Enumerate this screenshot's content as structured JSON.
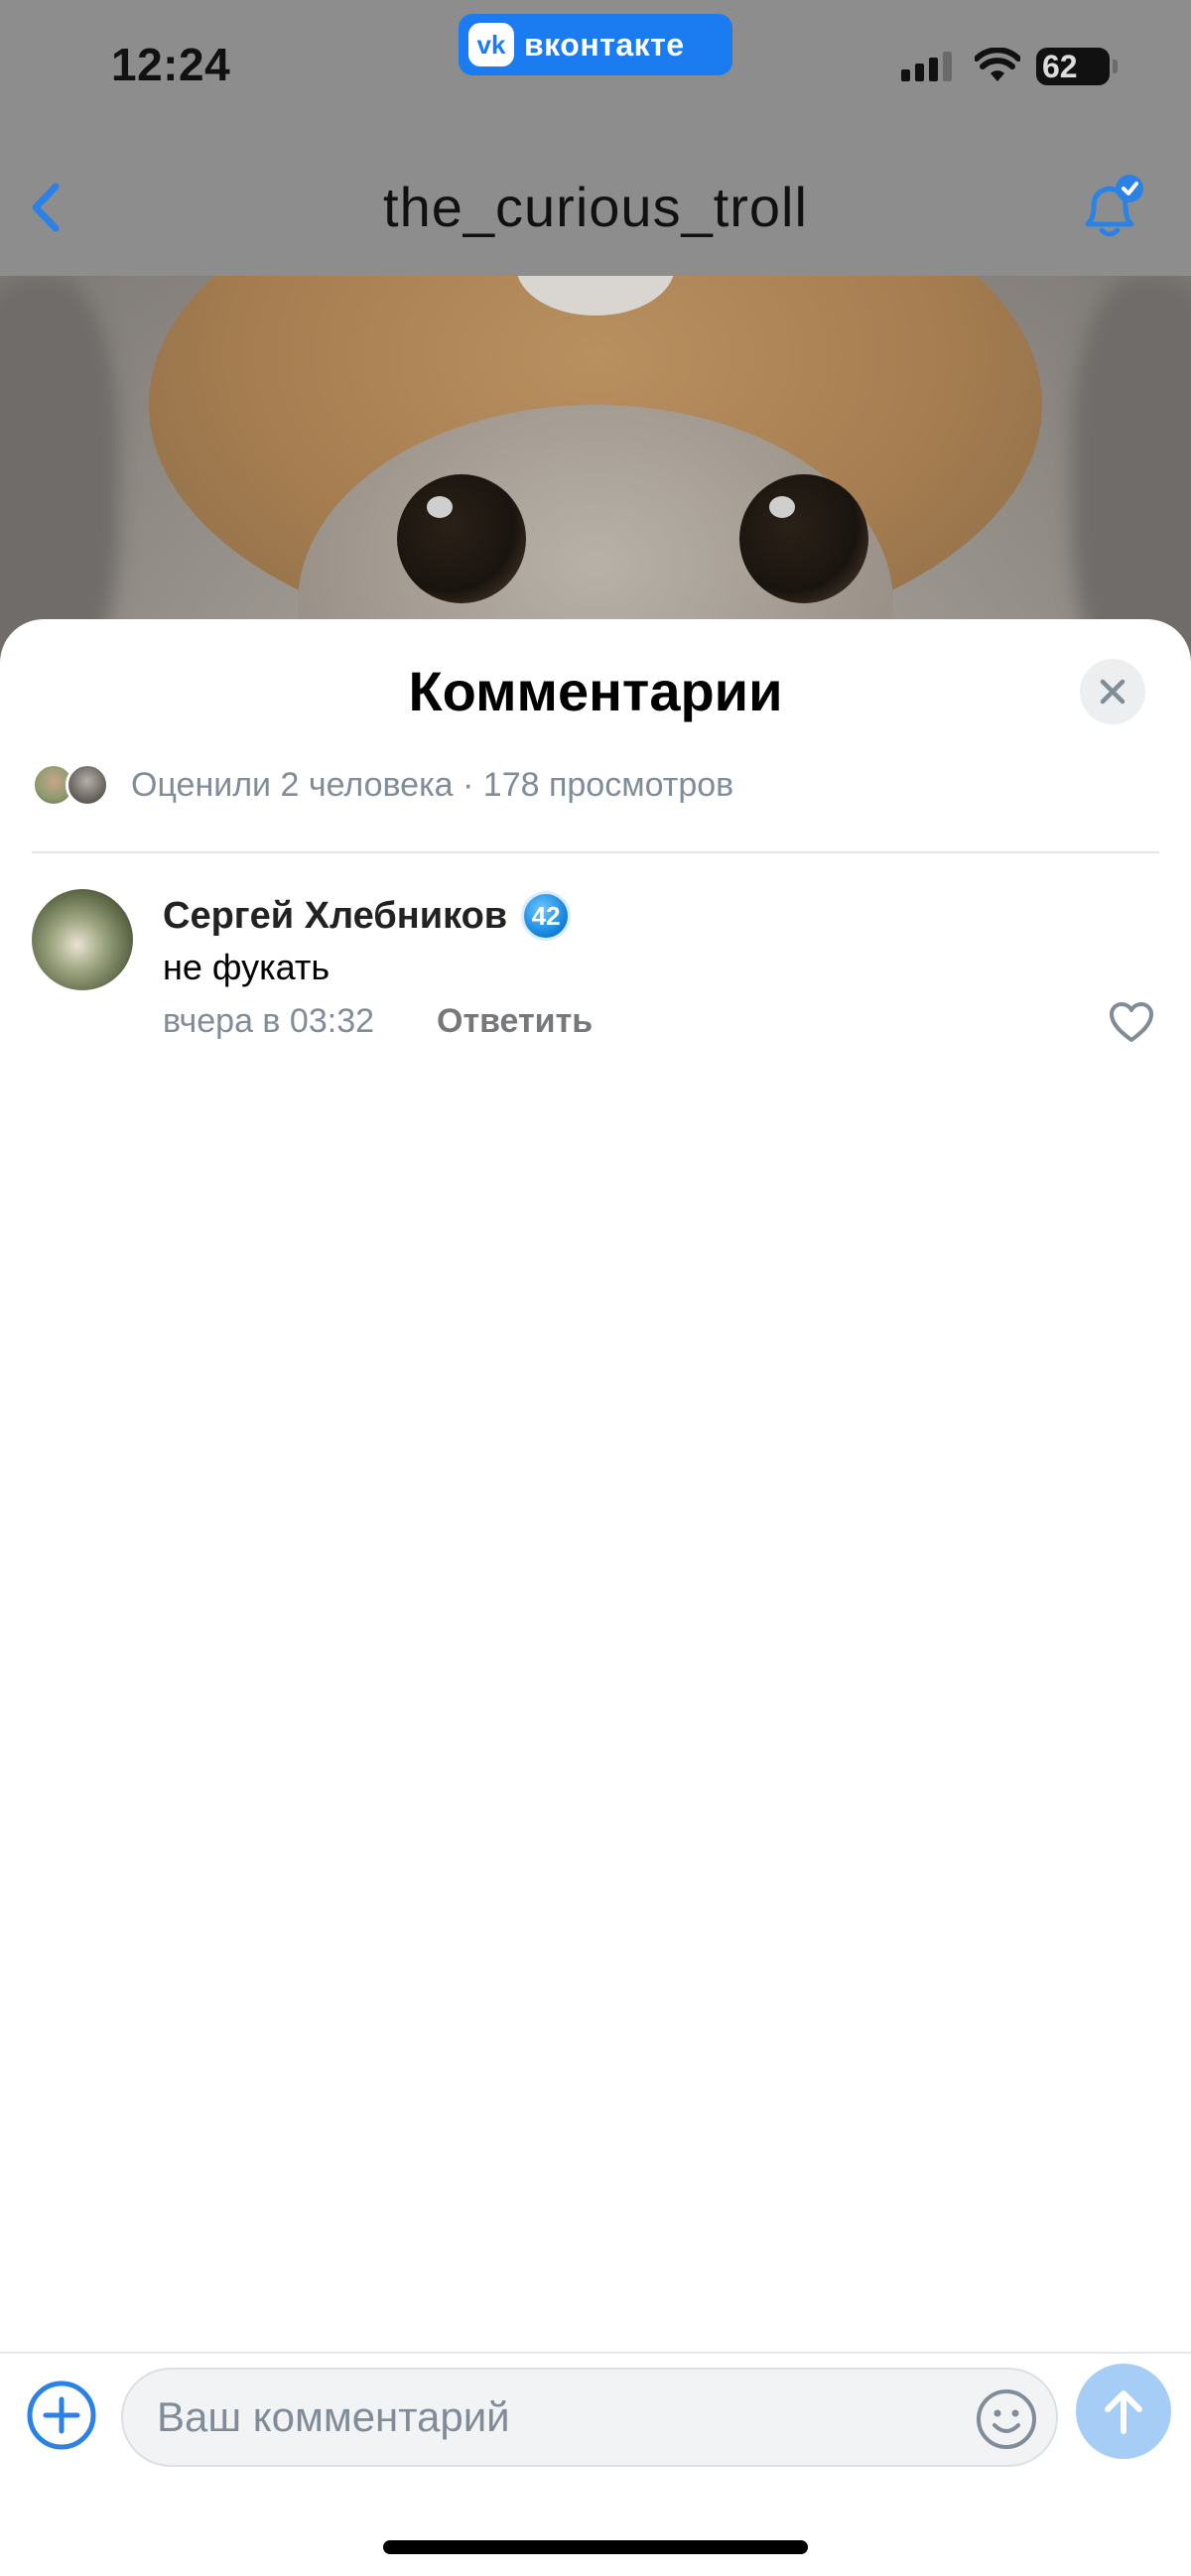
{
  "status_bar": {
    "time": "12:24",
    "battery": "62",
    "app_badge": {
      "logo": "vk",
      "name": "вконтакте"
    }
  },
  "nav": {
    "title": "the_curious_troll",
    "back_icon": "chevron-left-icon",
    "bell_icon": "bell-check-icon"
  },
  "sheet": {
    "title": "Комментарии",
    "likes_text": "Оценили 2 человека · 178 просмотров"
  },
  "comments": [
    {
      "author": "Сергей Хлебников",
      "badge": "42",
      "text": "не фукать",
      "time": "вчера в 03:32",
      "reply_label": "Ответить"
    }
  ],
  "composer": {
    "placeholder": "Ваш комментарий"
  },
  "colors": {
    "accent": "#1a7cf0",
    "icon_blue": "#2b82e6",
    "secondary_text": "#818c99",
    "send_disabled": "#a6cdf5"
  }
}
